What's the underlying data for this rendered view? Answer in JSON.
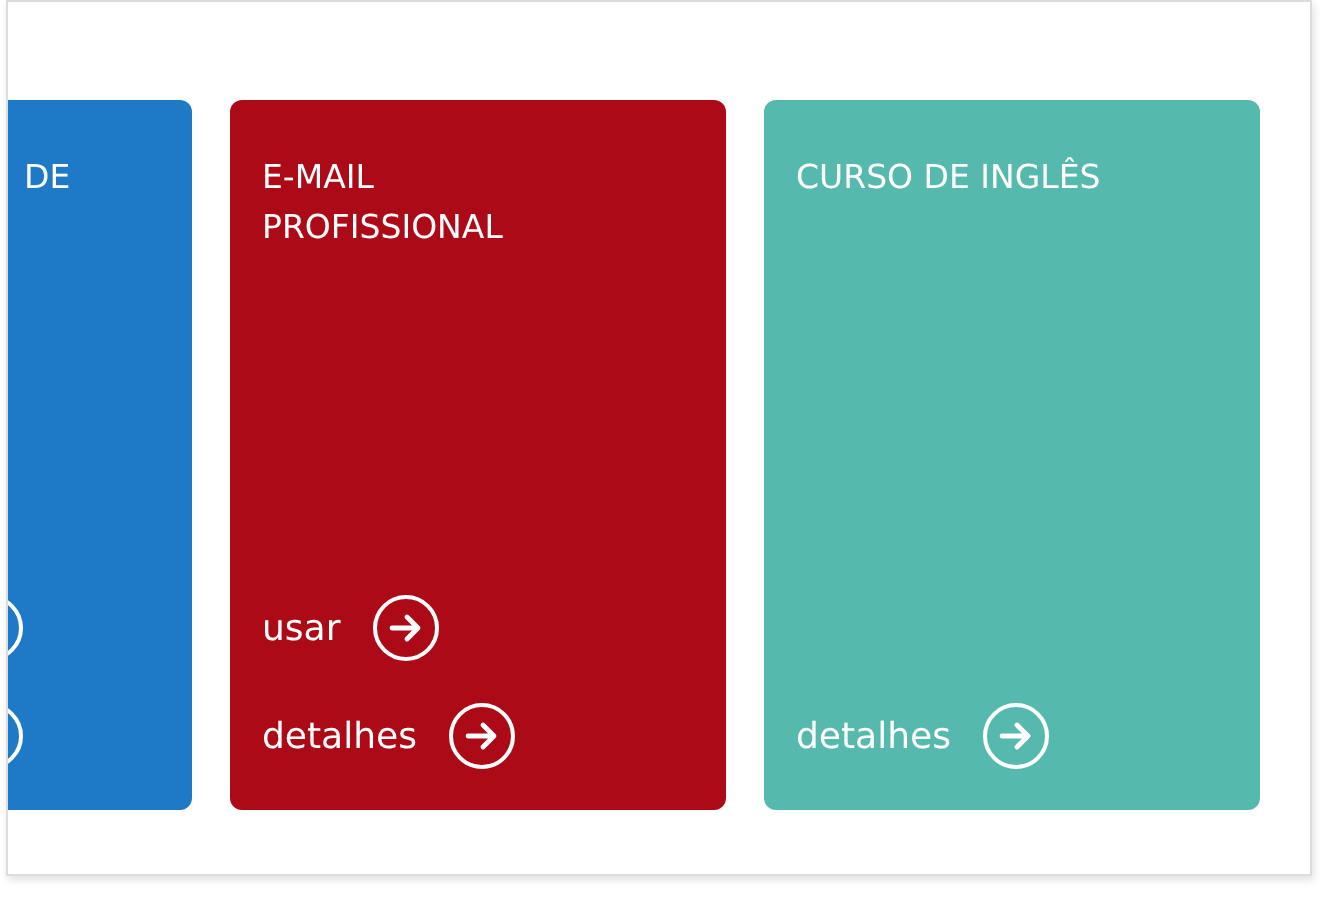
{
  "cards": [
    {
      "kind": "cut",
      "title": "DE",
      "color": "#1e7ac6",
      "links": [
        {
          "kind": "icon"
        },
        {
          "kind": "icon"
        }
      ]
    },
    {
      "kind": "full",
      "title": "E-MAIL PROFISSIONAL",
      "color": "#ad0a17",
      "links": [
        {
          "kind": "labeled",
          "label": "usar"
        },
        {
          "kind": "labeled",
          "label": "detalhes"
        }
      ]
    },
    {
      "kind": "full",
      "title": "CURSO DE INGLÊS",
      "color": "#56b9ae",
      "links": [
        {
          "kind": "labeled",
          "label": "detalhes"
        }
      ]
    }
  ]
}
